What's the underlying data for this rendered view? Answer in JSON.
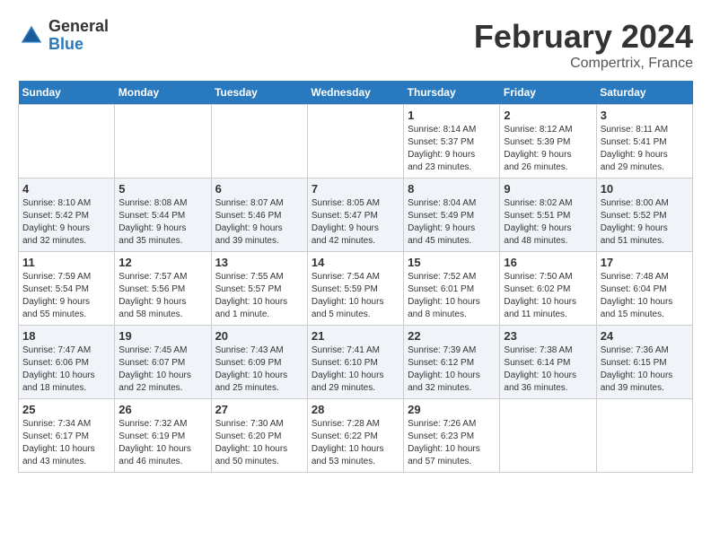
{
  "header": {
    "logo_general": "General",
    "logo_blue": "Blue",
    "month_title": "February 2024",
    "location": "Compertrix, France"
  },
  "days_of_week": [
    "Sunday",
    "Monday",
    "Tuesday",
    "Wednesday",
    "Thursday",
    "Friday",
    "Saturday"
  ],
  "weeks": [
    [
      {
        "day": "",
        "info": ""
      },
      {
        "day": "",
        "info": ""
      },
      {
        "day": "",
        "info": ""
      },
      {
        "day": "",
        "info": ""
      },
      {
        "day": "1",
        "info": "Sunrise: 8:14 AM\nSunset: 5:37 PM\nDaylight: 9 hours\nand 23 minutes."
      },
      {
        "day": "2",
        "info": "Sunrise: 8:12 AM\nSunset: 5:39 PM\nDaylight: 9 hours\nand 26 minutes."
      },
      {
        "day": "3",
        "info": "Sunrise: 8:11 AM\nSunset: 5:41 PM\nDaylight: 9 hours\nand 29 minutes."
      }
    ],
    [
      {
        "day": "4",
        "info": "Sunrise: 8:10 AM\nSunset: 5:42 PM\nDaylight: 9 hours\nand 32 minutes."
      },
      {
        "day": "5",
        "info": "Sunrise: 8:08 AM\nSunset: 5:44 PM\nDaylight: 9 hours\nand 35 minutes."
      },
      {
        "day": "6",
        "info": "Sunrise: 8:07 AM\nSunset: 5:46 PM\nDaylight: 9 hours\nand 39 minutes."
      },
      {
        "day": "7",
        "info": "Sunrise: 8:05 AM\nSunset: 5:47 PM\nDaylight: 9 hours\nand 42 minutes."
      },
      {
        "day": "8",
        "info": "Sunrise: 8:04 AM\nSunset: 5:49 PM\nDaylight: 9 hours\nand 45 minutes."
      },
      {
        "day": "9",
        "info": "Sunrise: 8:02 AM\nSunset: 5:51 PM\nDaylight: 9 hours\nand 48 minutes."
      },
      {
        "day": "10",
        "info": "Sunrise: 8:00 AM\nSunset: 5:52 PM\nDaylight: 9 hours\nand 51 minutes."
      }
    ],
    [
      {
        "day": "11",
        "info": "Sunrise: 7:59 AM\nSunset: 5:54 PM\nDaylight: 9 hours\nand 55 minutes."
      },
      {
        "day": "12",
        "info": "Sunrise: 7:57 AM\nSunset: 5:56 PM\nDaylight: 9 hours\nand 58 minutes."
      },
      {
        "day": "13",
        "info": "Sunrise: 7:55 AM\nSunset: 5:57 PM\nDaylight: 10 hours\nand 1 minute."
      },
      {
        "day": "14",
        "info": "Sunrise: 7:54 AM\nSunset: 5:59 PM\nDaylight: 10 hours\nand 5 minutes."
      },
      {
        "day": "15",
        "info": "Sunrise: 7:52 AM\nSunset: 6:01 PM\nDaylight: 10 hours\nand 8 minutes."
      },
      {
        "day": "16",
        "info": "Sunrise: 7:50 AM\nSunset: 6:02 PM\nDaylight: 10 hours\nand 11 minutes."
      },
      {
        "day": "17",
        "info": "Sunrise: 7:48 AM\nSunset: 6:04 PM\nDaylight: 10 hours\nand 15 minutes."
      }
    ],
    [
      {
        "day": "18",
        "info": "Sunrise: 7:47 AM\nSunset: 6:06 PM\nDaylight: 10 hours\nand 18 minutes."
      },
      {
        "day": "19",
        "info": "Sunrise: 7:45 AM\nSunset: 6:07 PM\nDaylight: 10 hours\nand 22 minutes."
      },
      {
        "day": "20",
        "info": "Sunrise: 7:43 AM\nSunset: 6:09 PM\nDaylight: 10 hours\nand 25 minutes."
      },
      {
        "day": "21",
        "info": "Sunrise: 7:41 AM\nSunset: 6:10 PM\nDaylight: 10 hours\nand 29 minutes."
      },
      {
        "day": "22",
        "info": "Sunrise: 7:39 AM\nSunset: 6:12 PM\nDaylight: 10 hours\nand 32 minutes."
      },
      {
        "day": "23",
        "info": "Sunrise: 7:38 AM\nSunset: 6:14 PM\nDaylight: 10 hours\nand 36 minutes."
      },
      {
        "day": "24",
        "info": "Sunrise: 7:36 AM\nSunset: 6:15 PM\nDaylight: 10 hours\nand 39 minutes."
      }
    ],
    [
      {
        "day": "25",
        "info": "Sunrise: 7:34 AM\nSunset: 6:17 PM\nDaylight: 10 hours\nand 43 minutes."
      },
      {
        "day": "26",
        "info": "Sunrise: 7:32 AM\nSunset: 6:19 PM\nDaylight: 10 hours\nand 46 minutes."
      },
      {
        "day": "27",
        "info": "Sunrise: 7:30 AM\nSunset: 6:20 PM\nDaylight: 10 hours\nand 50 minutes."
      },
      {
        "day": "28",
        "info": "Sunrise: 7:28 AM\nSunset: 6:22 PM\nDaylight: 10 hours\nand 53 minutes."
      },
      {
        "day": "29",
        "info": "Sunrise: 7:26 AM\nSunset: 6:23 PM\nDaylight: 10 hours\nand 57 minutes."
      },
      {
        "day": "",
        "info": ""
      },
      {
        "day": "",
        "info": ""
      }
    ]
  ]
}
